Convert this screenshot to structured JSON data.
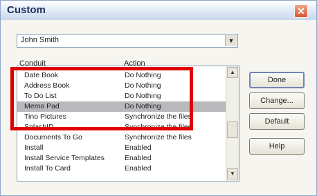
{
  "window": {
    "title": "Custom"
  },
  "user_select": {
    "value": "John Smith"
  },
  "columns": {
    "conduit": "Conduit",
    "action": "Action"
  },
  "rows": [
    {
      "conduit": "Date Book",
      "action": "Do Nothing",
      "selected": false
    },
    {
      "conduit": "Address Book",
      "action": "Do Nothing",
      "selected": false
    },
    {
      "conduit": "To Do List",
      "action": "Do Nothing",
      "selected": false
    },
    {
      "conduit": "Memo Pad",
      "action": "Do Nothing",
      "selected": true
    },
    {
      "conduit": "Tino Pictures",
      "action": "Synchronize the files",
      "selected": false
    },
    {
      "conduit": "SplashID",
      "action": "Synchronize the files",
      "selected": false
    },
    {
      "conduit": "Documents To Go",
      "action": "Synchronize the files",
      "selected": false
    },
    {
      "conduit": "Install",
      "action": "Enabled",
      "selected": false
    },
    {
      "conduit": "Install Service Templates",
      "action": "Enabled",
      "selected": false
    },
    {
      "conduit": "Install To Card",
      "action": "Enabled",
      "selected": false
    }
  ],
  "buttons": {
    "done": "Done",
    "change": "Change...",
    "default": "Default",
    "help": "Help"
  },
  "colors": {
    "highlight_box": "#e00000",
    "selected_row": "#b9b8bd"
  }
}
